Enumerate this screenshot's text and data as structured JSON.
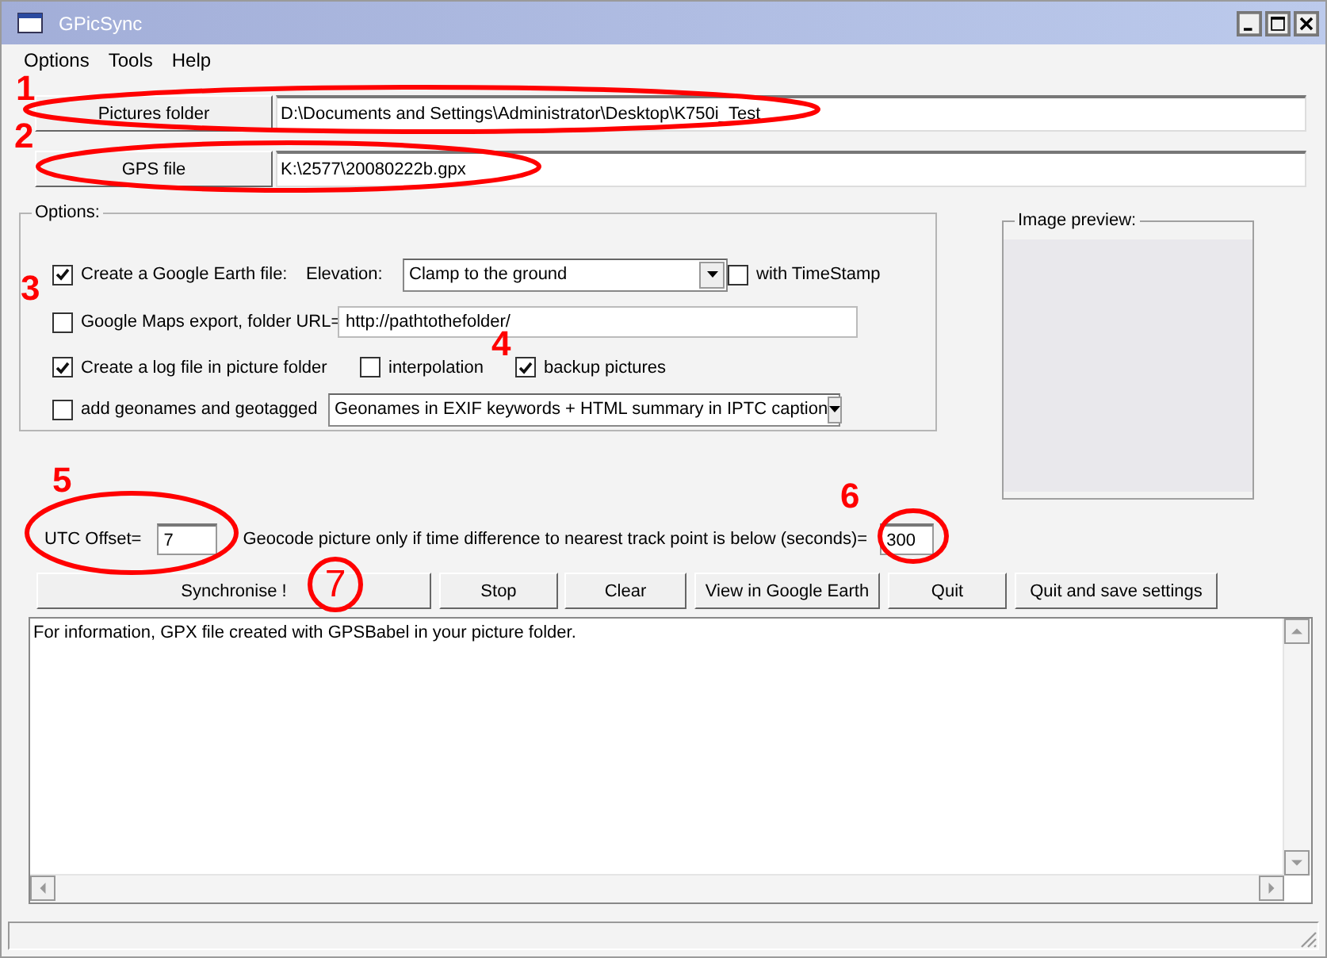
{
  "window": {
    "title": "GPicSync"
  },
  "menu": [
    {
      "label": "Options"
    },
    {
      "label": "Tools"
    },
    {
      "label": "Help"
    }
  ],
  "paths": [
    {
      "button": "Pictures folder",
      "value": "D:\\Documents and Settings\\Administrator\\Desktop\\K750i_Test"
    },
    {
      "button": "GPS file",
      "value": "K:\\2577\\20080222b.gpx"
    }
  ],
  "options": {
    "title": "Options:",
    "rows": [
      [
        {
          "kind": "checkbox",
          "label": "Create a Google Earth file:",
          "checked": true
        },
        {
          "kind": "label",
          "text": "Elevation:"
        },
        {
          "kind": "select",
          "value": "Clamp to the ground"
        },
        {
          "kind": "checkbox",
          "label": "with TimeStamp",
          "checked": false
        }
      ],
      [
        {
          "kind": "checkbox",
          "label": "Google Maps export, folder URL=",
          "checked": false
        },
        {
          "kind": "input",
          "value": "http://pathtothefolder/"
        }
      ],
      [
        {
          "kind": "checkbox",
          "label": "Create a log file in picture folder",
          "checked": true
        },
        {
          "kind": "checkbox",
          "label": "interpolation",
          "checked": false
        },
        {
          "kind": "checkbox",
          "label": "backup pictures",
          "checked": true
        }
      ],
      [
        {
          "kind": "checkbox",
          "label": "add geonames and geotagged",
          "checked": false
        },
        {
          "kind": "select",
          "value": "Geonames in EXIF keywords + HTML summary in IPTC caption"
        }
      ]
    ]
  },
  "preview": {
    "title": "Image preview:"
  },
  "utc": {
    "label": "UTC Offset=",
    "value": "7"
  },
  "geocode": {
    "label": "Geocode picture only if time difference to nearest track point is below (seconds)=",
    "value": "300"
  },
  "buttons": [
    {
      "label": "Synchronise !"
    },
    {
      "label": "Stop"
    },
    {
      "label": "Clear"
    },
    {
      "label": "View in Google Earth"
    },
    {
      "label": "Quit"
    },
    {
      "label": "Quit and save settings"
    }
  ],
  "log": {
    "text": "For information, GPX file created with GPSBabel in your picture folder."
  },
  "annotations": [
    {
      "label": "1",
      "kind": "number"
    },
    {
      "label": "2",
      "kind": "number"
    },
    {
      "label": "3",
      "kind": "number"
    },
    {
      "label": "4",
      "kind": "number"
    },
    {
      "label": "5",
      "kind": "number"
    },
    {
      "label": "6",
      "kind": "number"
    },
    {
      "label": "7",
      "kind": "circled"
    }
  ]
}
